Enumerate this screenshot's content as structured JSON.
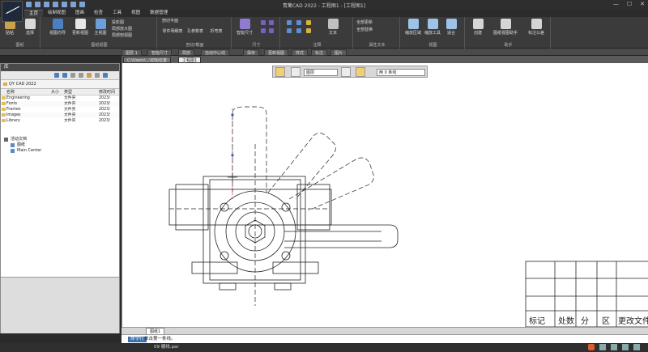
{
  "titlebar": {
    "title": "青篱CAD 2022 - 工程图1 - [工程图1]"
  },
  "ribbon_tabs": [
    "主页",
    "绘制视图",
    "图画",
    "检查",
    "工具",
    "视图",
    "数据管理"
  ],
  "ribbon_groups": [
    {
      "label": "图纸",
      "buttons": [
        "贴粘",
        "选择"
      ]
    },
    {
      "label": "图纸视图",
      "buttons": [
        "视图向导",
        "更新视图",
        "主视图"
      ],
      "small": [
        "投影图",
        "局部放大图",
        "局部剖视图"
      ]
    },
    {
      "label": "剖切/截面",
      "buttons": [
        "零件明细表",
        "孔参数表",
        "折弯表"
      ],
      "small": [
        "剖切平面",
        "剖视图",
        "截面图"
      ]
    },
    {
      "label": "尺寸",
      "buttons": [
        "智能尺寸"
      ]
    },
    {
      "label": "注释",
      "buttons": [
        "文本"
      ]
    },
    {
      "label": "属性文本",
      "buttons": [
        "全部更新",
        "全部替换"
      ]
    },
    {
      "label": "剪贴板",
      "buttons": [
        "缩放区域",
        "缩放工具",
        "适合"
      ]
    },
    {
      "label": "视图",
      "buttons": [
        "隐藏显示"
      ]
    },
    {
      "label": "助手",
      "buttons": [
        "创建",
        "图纸视图助手",
        "局部尺寸",
        "标注公差"
      ]
    }
  ],
  "doc_tabs": [
    "图层 1",
    "智能尺寸",
    "局部",
    "自动中心线",
    "保存",
    "更新视图",
    "样式",
    "标注",
    "图片"
  ],
  "active_doc_tabs": [
    "C:\\Users\\...\\初始位置",
    "工程图1"
  ],
  "props_bar": {
    "layer": "图层",
    "linetype": "两 0 条线"
  },
  "library": {
    "title": "库",
    "path": "QY CAD 2022",
    "columns": [
      "名称",
      "大小",
      "类型",
      "修改时间"
    ],
    "rows": [
      {
        "name": "Engineering",
        "size": "",
        "type": "文件夹",
        "date": "2023/"
      },
      {
        "name": "Fonts",
        "size": "",
        "type": "文件夹",
        "date": "2023/"
      },
      {
        "name": "Frames",
        "size": "",
        "type": "文件夹",
        "date": "2023/"
      },
      {
        "name": "Images",
        "size": "",
        "type": "文件夹",
        "date": "2023/"
      },
      {
        "name": "Library",
        "size": "",
        "type": "文件夹",
        "date": "2023/"
      }
    ],
    "tree": [
      "活动文档",
      "图纸",
      "Main Center"
    ]
  },
  "title_block": {
    "labels": [
      "标记",
      "处数",
      "分",
      "区",
      "更改文件"
    ]
  },
  "sheet_tab": "图纸1",
  "command_line": {
    "label": "命令行",
    "prompt": "单击第一条线。"
  },
  "statusbar": {
    "text": "09 绷线.par"
  },
  "colors": {
    "accent": "#3a6fb0",
    "ribbon": "#3b3b3b",
    "canvas": "#ffffff"
  }
}
